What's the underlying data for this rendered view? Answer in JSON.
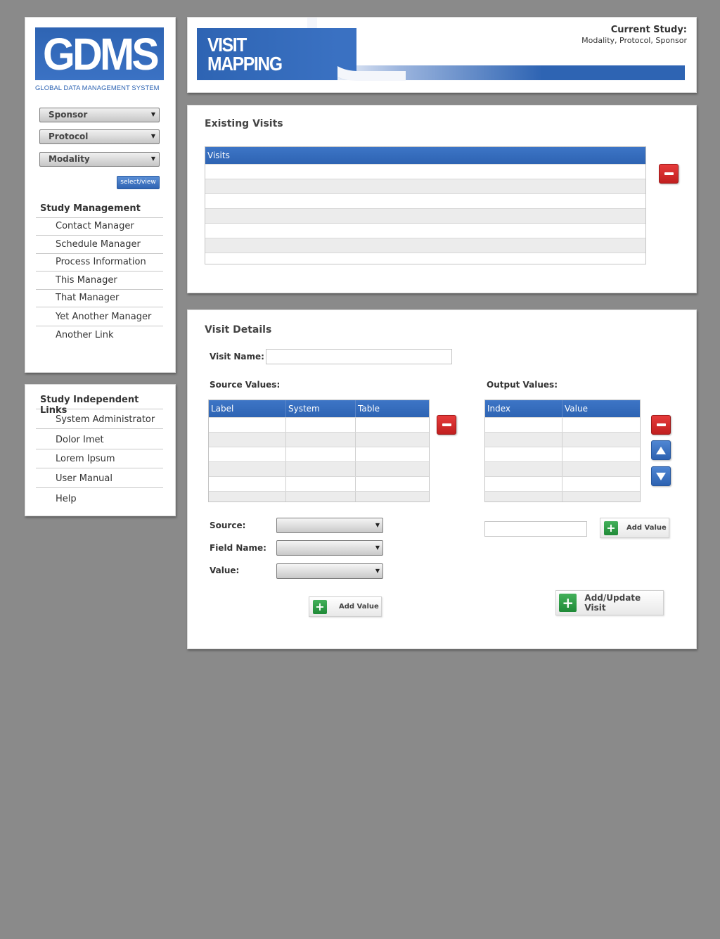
{
  "app": {
    "logo_text": "GDMS",
    "logo_subtitle": "GLOBAL DATA MANAGEMENT SYSTEM"
  },
  "filters": {
    "sponsor": "Sponsor",
    "protocol": "Protocol",
    "modality": "Modality",
    "select_view_label": "select/view"
  },
  "study_management": {
    "heading": "Study Management",
    "items": [
      "Contact Manager",
      "Schedule Manager",
      "Process Information",
      "This Manager",
      "That Manager",
      "Yet Another Manager",
      "Another Link"
    ]
  },
  "study_independent": {
    "heading": "Study Independent Links",
    "items": [
      "System Administrator",
      "Dolor Imet",
      "Lorem Ipsum",
      "User Manual",
      "Help"
    ]
  },
  "header": {
    "title_line1": "VISIT",
    "title_line2": "MAPPING",
    "current_study_label": "Current Study:",
    "current_study_value": "Modality, Protocol, Sponsor"
  },
  "existing_visits": {
    "title": "Existing Visits",
    "column": "Visits",
    "rows": 7
  },
  "visit_details": {
    "title": "Visit Details",
    "visit_name_label": "Visit Name:",
    "visit_name_value": "",
    "source_values_label": "Source Values:",
    "source_columns": [
      "Label",
      "System",
      "Table"
    ],
    "output_values_label": "Output Values:",
    "output_columns": [
      "Index",
      "Value"
    ],
    "source_label": "Source:",
    "field_name_label": "Field Name:",
    "value_label": "Value:",
    "add_value_label": "Add Value",
    "output_add_value_label": "Add Value",
    "add_update_label": "Add/Update Visit"
  }
}
